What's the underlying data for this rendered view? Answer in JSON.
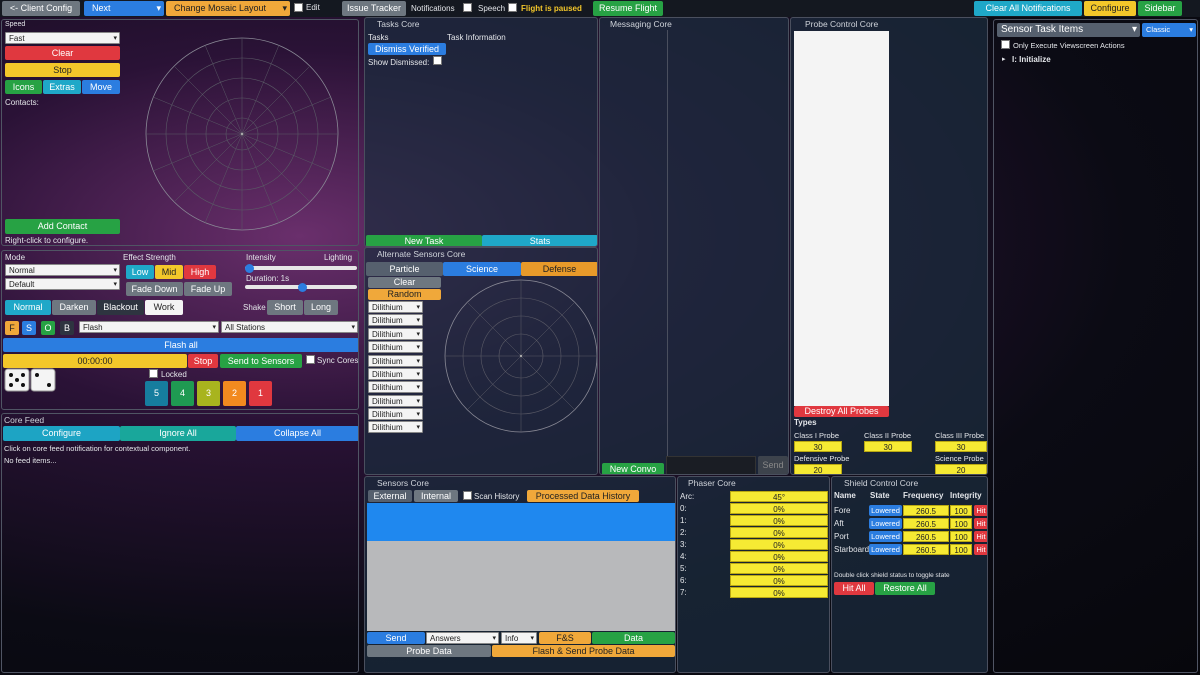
{
  "top_bar": {
    "client_config": "<- Client Config",
    "next_select": "Next",
    "mosaic_select": "Change Mosaic Layout",
    "edit_label": "Edit",
    "issue_tracker": "Issue Tracker",
    "notifications_label": "Notifications",
    "speech_label": "Speech",
    "flight_status": "Flight is paused",
    "resume_flight": "Resume Flight",
    "clear_notifications": "Clear All Notifications",
    "configure": "Configure",
    "sidebar": "Sidebar"
  },
  "thrusters": {
    "speed_label": "Speed",
    "speed_value": "Fast",
    "clear": "Clear",
    "stop": "Stop",
    "icons": "Icons",
    "extras": "Extras",
    "move": "Move",
    "contacts_label": "Contacts:",
    "add_contact": "Add Contact",
    "hint": "Right-click to configure."
  },
  "lighting": {
    "mode_label": "Mode",
    "mode_value": "Normal",
    "mode2_value": "Default",
    "effect_strength": "Effect Strength",
    "low": "Low",
    "mid": "Mid",
    "high": "High",
    "fade_down": "Fade Down",
    "fade_up": "Fade Up",
    "intensity": "Intensity",
    "lighting": "Lighting",
    "duration": "Duration: 1s",
    "normal": "Normal",
    "darken": "Darken",
    "blackout": "Blackout",
    "work": "Work",
    "shake": "Shake",
    "short": "Short",
    "long": "Long",
    "f_btn": "F",
    "s_btn": "S",
    "o_btn": "O",
    "b_btn": "B",
    "flash_select": "Flash",
    "stations_select": "All Stations",
    "flash_all": "Flash all",
    "timer": "00:00:00",
    "stop": "Stop",
    "send_to_sensors": "Send to Sensors",
    "sync_cores": "Sync Cores",
    "locked": "Locked",
    "dice": [
      "5",
      "4",
      "3",
      "2",
      "1"
    ]
  },
  "core_feed": {
    "title": "Core Feed",
    "configure": "Configure",
    "ignore_all": "Ignore All",
    "collapse_all": "Collapse All",
    "hint": "Click on core feed notification for contextual component.",
    "empty": "No feed items..."
  },
  "tasks_core": {
    "title": "Tasks Core",
    "tasks_col": "Tasks",
    "info_col": "Task Information",
    "dismiss_verified": "Dismiss Verified",
    "show_dismissed": "Show Dismissed:",
    "new_task": "New Task",
    "stats": "Stats"
  },
  "alt_sensors": {
    "title": "Alternate Sensors Core",
    "particle": "Particle",
    "science": "Science",
    "defense": "Defense",
    "clear": "Clear",
    "random": "Random",
    "dilithium": [
      "Dilithium",
      "Dilithium",
      "Dilithium",
      "Dilithium",
      "Dilithium",
      "Dilithium",
      "Dilithium",
      "Dilithium",
      "Dilithium",
      "Dilithium"
    ]
  },
  "messaging": {
    "title": "Messaging Core",
    "new_convo": "New Convo",
    "send": "Send"
  },
  "probe_control": {
    "title": "Probe Control Core",
    "destroy_all": "Destroy All Probes",
    "types": "Types",
    "probes": [
      {
        "name": "Class I Probe",
        "value": "30"
      },
      {
        "name": "Class II Probe",
        "value": "30"
      },
      {
        "name": "Class III Probe",
        "value": "30"
      },
      {
        "name": "Defensive Probe",
        "value": "20"
      },
      {
        "name": "Science Probe",
        "value": "20"
      }
    ]
  },
  "sensors_core": {
    "title": "Sensors Core",
    "external": "External",
    "internal": "Internal",
    "scan_history": "Scan History",
    "processed": "Processed Data History",
    "send": "Send",
    "answers": "Answers",
    "info": "Info",
    "fs": "F&S",
    "data": "Data",
    "probe_data": "Probe Data",
    "flash_send": "Flash & Send Probe Data"
  },
  "phaser_core": {
    "title": "Phaser Core",
    "arc_label": "Arc:",
    "arc_value": "45°",
    "rows": [
      {
        "label": "0:",
        "value": "0%"
      },
      {
        "label": "1:",
        "value": "0%"
      },
      {
        "label": "2:",
        "value": "0%"
      },
      {
        "label": "3:",
        "value": "0%"
      },
      {
        "label": "4:",
        "value": "0%"
      },
      {
        "label": "5:",
        "value": "0%"
      },
      {
        "label": "6:",
        "value": "0%"
      },
      {
        "label": "7:",
        "value": "0%"
      }
    ]
  },
  "shield_core": {
    "title": "Shield Control Core",
    "headers": [
      "Name",
      "State",
      "Frequency",
      "Integrity"
    ],
    "rows": [
      {
        "name": "Fore",
        "state": "Lowered",
        "freq": "260.5",
        "integ": "100",
        "hit": "Hit"
      },
      {
        "name": "Aft",
        "state": "Lowered",
        "freq": "260.5",
        "integ": "100",
        "hit": "Hit"
      },
      {
        "name": "Port",
        "state": "Lowered",
        "freq": "260.5",
        "integ": "100",
        "hit": "Hit"
      },
      {
        "name": "Starboard",
        "state": "Lowered",
        "freq": "260.5",
        "integ": "100",
        "hit": "Hit"
      }
    ],
    "hint": "Double click shield status to toggle state",
    "hit_all": "Hit All",
    "restore_all": "Restore All"
  },
  "sidebar": {
    "select_value": "Sensor Task Items",
    "mode_value": "Classic",
    "only_execute": "Only Execute Viewscreen Actions",
    "item": "I: Initialize"
  },
  "colors": {
    "accent_blue": "#2b7de0",
    "green": "#27a244",
    "red": "#e0383f",
    "yellow": "#f3c72a"
  }
}
